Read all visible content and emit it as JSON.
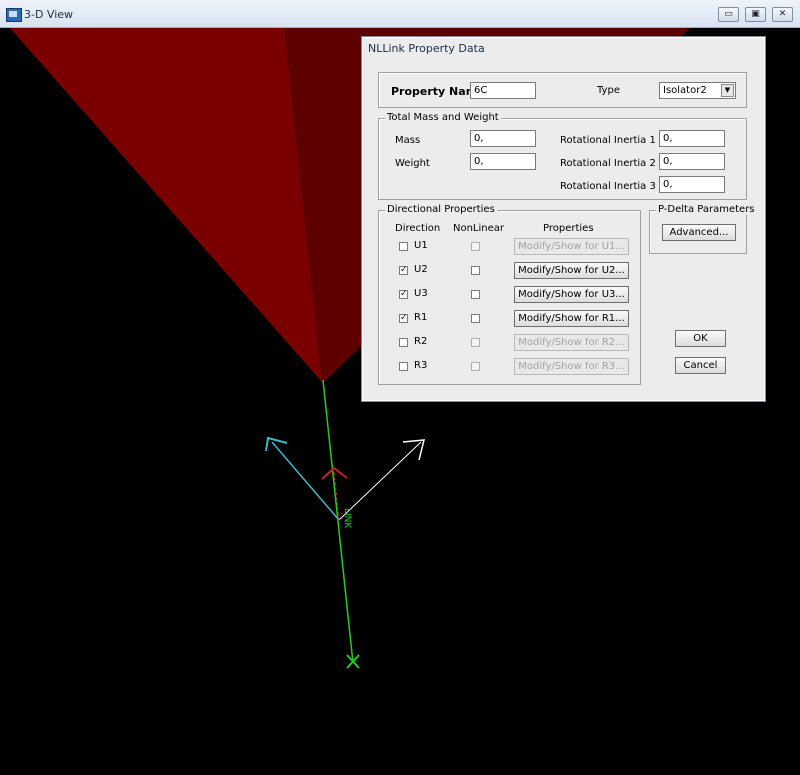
{
  "window": {
    "title": "3-D View",
    "minimize": "▭",
    "restore": "▣",
    "close": "✕"
  },
  "dialog": {
    "title": "NLLink Property Data",
    "property_name_label": "Property Name",
    "property_name_value": "6C",
    "type_label": "Type",
    "type_value": "Isolator2",
    "mass_section": {
      "legend": "Total Mass and Weight",
      "mass_label": "Mass",
      "mass_value": "0,",
      "weight_label": "Weight",
      "weight_value": "0,",
      "ri1_label": "Rotational Inertia 1",
      "ri1_value": "0,",
      "ri2_label": "Rotational Inertia 2",
      "ri2_value": "0,",
      "ri3_label": "Rotational Inertia 3",
      "ri3_value": "0,"
    },
    "directional": {
      "legend": "Directional Properties",
      "col_direction": "Direction",
      "col_nonlinear": "NonLinear",
      "col_properties": "Properties",
      "rows": [
        {
          "dir": "U1",
          "checked": false,
          "enabled": false,
          "button": "Modify/Show for U1..."
        },
        {
          "dir": "U2",
          "checked": true,
          "enabled": true,
          "button": "Modify/Show for U2..."
        },
        {
          "dir": "U3",
          "checked": true,
          "enabled": true,
          "button": "Modify/Show for U3..."
        },
        {
          "dir": "R1",
          "checked": true,
          "enabled": true,
          "button": "Modify/Show for R1..."
        },
        {
          "dir": "R2",
          "checked": false,
          "enabled": false,
          "button": "Modify/Show for R2..."
        },
        {
          "dir": "R3",
          "checked": false,
          "enabled": false,
          "button": "Modify/Show for R3..."
        }
      ]
    },
    "pdelta": {
      "legend": "P-Delta Parameters",
      "button": "Advanced..."
    },
    "ok": "OK",
    "cancel": "Cancel"
  },
  "viewport": {
    "link_label": "LINK",
    "colors": {
      "solid": "#7a0000",
      "solid_dark": "#5e0000",
      "link": "#22cc22",
      "axis_cyan": "#3fb8c8",
      "axis_white": "#ffffff",
      "axis_red": "#cc2020"
    }
  }
}
